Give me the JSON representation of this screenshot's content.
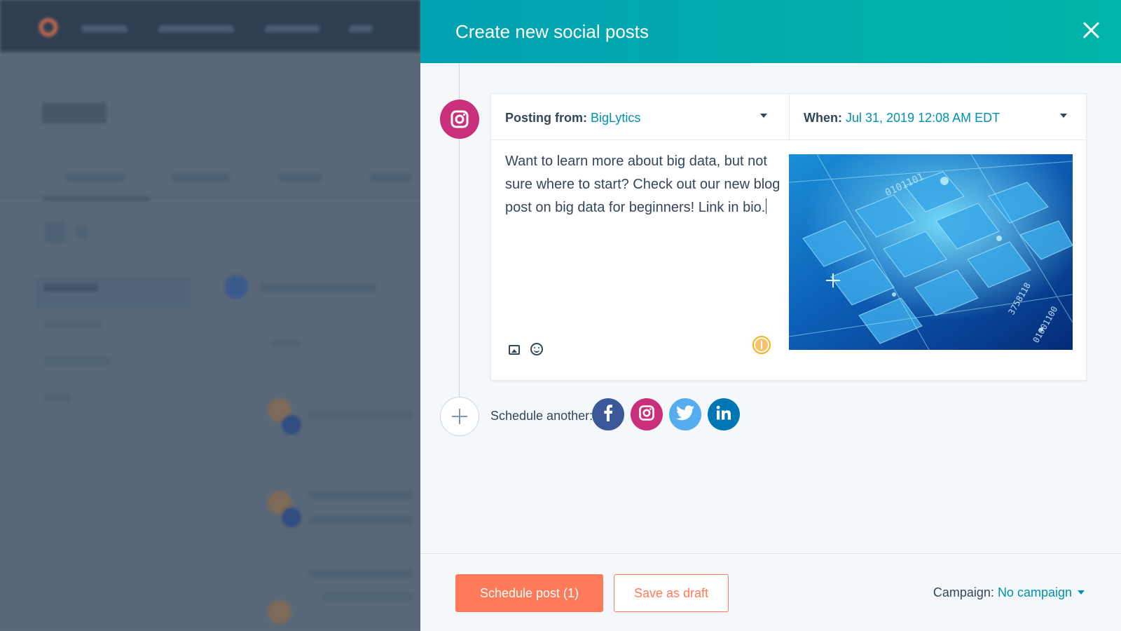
{
  "panel": {
    "title": "Create new social posts",
    "close_icon": "close-icon"
  },
  "post": {
    "network": "instagram",
    "posting_from_label": "Posting from:",
    "posting_from_value": "BigLytics",
    "when_label": "When:",
    "when_value": "Jul 31, 2019 12:08 AM EDT",
    "text": "Want to learn more about big data, but not sure where to start? Check out our new blog post on big data for beginners! Link in bio."
  },
  "schedule_another": {
    "label": "Schedule another:",
    "networks": [
      "facebook",
      "instagram",
      "twitter",
      "linkedin"
    ]
  },
  "footer": {
    "schedule_button": "Schedule post (1)",
    "draft_button": "Save as draft",
    "campaign_label": "Campaign:",
    "campaign_value": "No campaign"
  },
  "colors": {
    "header_start": "#00a2b2",
    "header_end": "#00b4a7",
    "accent": "#0091ae",
    "primary": "#ff7a59",
    "instagram": "#c92f7a",
    "facebook": "#3b5998",
    "twitter": "#55acee",
    "linkedin": "#0077b5"
  }
}
